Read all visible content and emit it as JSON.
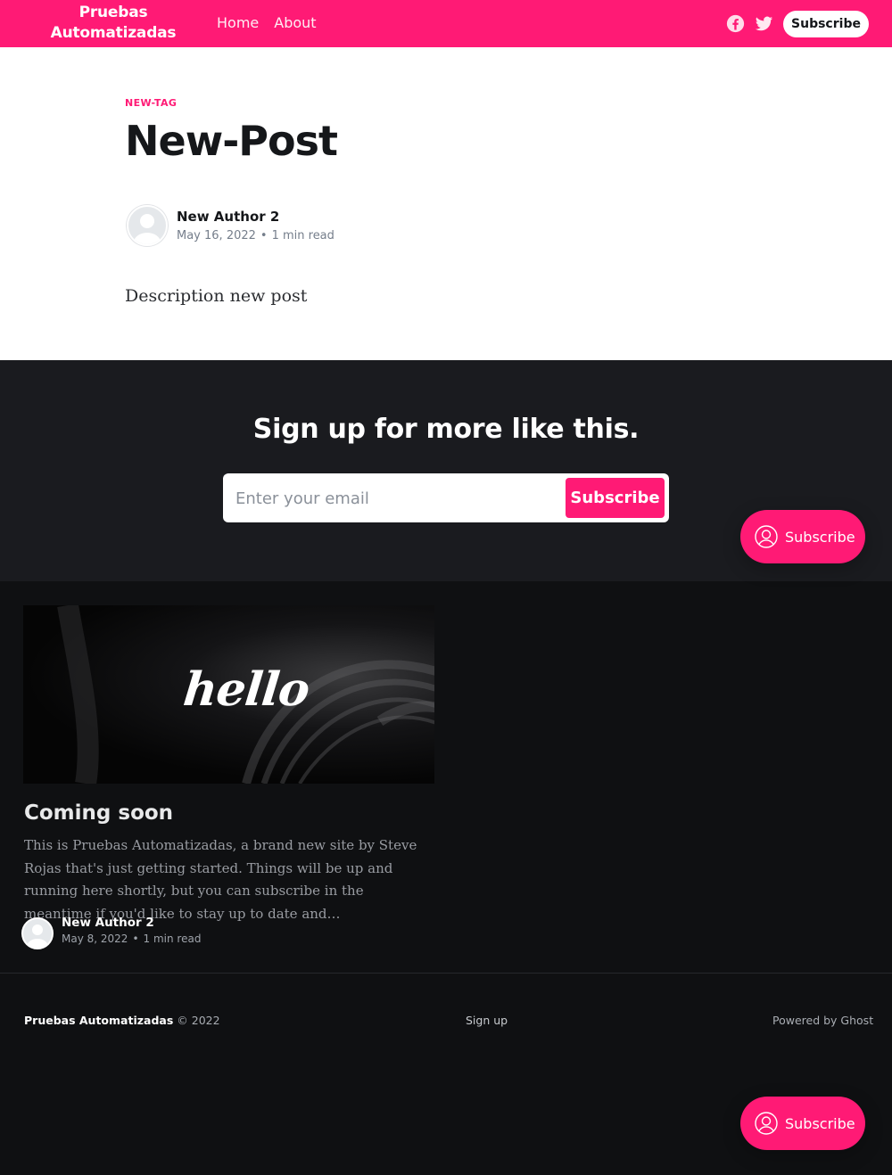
{
  "header": {
    "site_title": "Pruebas Automatizadas",
    "nav": [
      "Home",
      "About"
    ],
    "subscribe_label": "Subscribe",
    "icons": [
      "facebook-icon",
      "twitter-icon"
    ],
    "background": "#ff1a75"
  },
  "article": {
    "tag": "NEW-TAG",
    "title": "New-Post",
    "author": "New Author 2",
    "date": "May 16, 2022",
    "read_time": "1 min read",
    "excerpt": "Description new post"
  },
  "cta": {
    "title": "Sign up for more like this.",
    "email_placeholder": "Enter your email",
    "button_label": "Subscribe"
  },
  "portal": {
    "label": "Subscribe",
    "icon": "user-circle-icon"
  },
  "related": {
    "image_text": "hello",
    "title": "Coming soon",
    "excerpt": "This is Pruebas Automatizadas, a brand new site by Steve Rojas that's just getting started. Things will be up and running here shortly, but you can subscribe in the meantime if you'd like to stay up to date and…",
    "author": "New Author 2",
    "date": "May 8, 2022",
    "read_time": "1 min read"
  },
  "footer": {
    "site_name": "Pruebas Automatizadas",
    "copyright": "© 2022",
    "signup": "Sign up",
    "powered": "Powered by Ghost"
  },
  "colors": {
    "accent": "#ff1a75",
    "dark_bg": "#0f1012",
    "cta_bg": "#1a1b1f"
  }
}
